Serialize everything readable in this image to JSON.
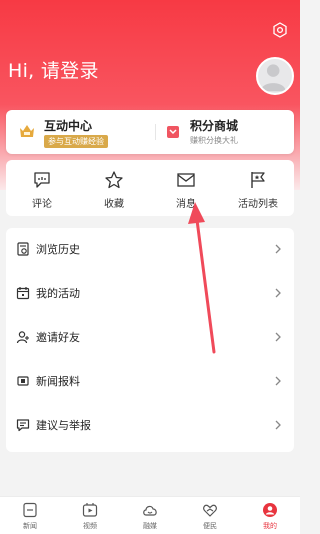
{
  "header": {
    "greeting": "Hi, 请登录",
    "colors": {
      "accent": "#f73a44",
      "gold": "#d9a94a"
    }
  },
  "cards": {
    "interaction_center": {
      "title": "互动中心",
      "subtitle": "参与互动赚经验"
    },
    "points_mall": {
      "title": "积分商城",
      "subtitle": "赚积分换大礼"
    }
  },
  "quick_actions": [
    {
      "label": "评论",
      "icon": "comment-icon"
    },
    {
      "label": "收藏",
      "icon": "star-icon"
    },
    {
      "label": "消息",
      "icon": "mail-icon"
    },
    {
      "label": "活动列表",
      "icon": "flag-icon"
    }
  ],
  "menu": [
    {
      "label": "浏览历史",
      "icon": "history-icon"
    },
    {
      "label": "我的活动",
      "icon": "calendar-icon"
    },
    {
      "label": "邀请好友",
      "icon": "person-add-icon"
    },
    {
      "label": "新闻报料",
      "icon": "news-tip-icon"
    },
    {
      "label": "建议与举报",
      "icon": "feedback-icon"
    }
  ],
  "tabbar": [
    {
      "label": "新闻",
      "icon": "news-icon"
    },
    {
      "label": "视频",
      "icon": "video-icon"
    },
    {
      "label": "融媒",
      "icon": "media-icon"
    },
    {
      "label": "便民",
      "icon": "heart-hands-icon"
    },
    {
      "label": "我的",
      "icon": "profile-icon",
      "active": true
    }
  ]
}
